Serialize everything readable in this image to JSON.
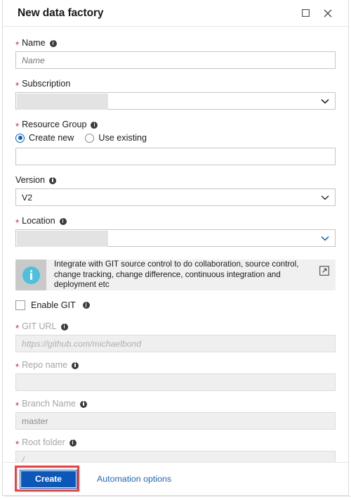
{
  "dialog": {
    "title": "New data factory",
    "titlebar_buttons": [
      {
        "name": "maximize-button",
        "icon": "maximize-icon",
        "label": "Maximize"
      },
      {
        "name": "close-button",
        "icon": "close-icon",
        "label": "Close"
      }
    ]
  },
  "fields": {
    "name": {
      "label": "Name",
      "required": true,
      "info": true,
      "placeholder": "Name",
      "value": ""
    },
    "subscription": {
      "label": "Subscription",
      "required": true,
      "info": false,
      "value": "",
      "redacted": true,
      "chevron_color": "#1b1b1b"
    },
    "resource_group": {
      "label": "Resource Group",
      "required": true,
      "info": true,
      "options": [
        {
          "label": "Create new",
          "selected": true
        },
        {
          "label": "Use existing",
          "selected": false
        }
      ],
      "value": "",
      "placeholder": ""
    },
    "version": {
      "label": "Version",
      "required": false,
      "info": true,
      "value": "V2",
      "chevron_color": "#1b1b1b"
    },
    "location": {
      "label": "Location",
      "required": true,
      "info": true,
      "value": "",
      "redacted": true,
      "chevron_color": "#1168d6"
    },
    "git_url": {
      "label": "GIT URL",
      "required": true,
      "info": true,
      "disabled": true,
      "placeholder": "https://github.com/michaelbond",
      "value": ""
    },
    "repo_name": {
      "label": "Repo name",
      "required": true,
      "info": true,
      "disabled": true,
      "placeholder": "",
      "value": ""
    },
    "branch_name": {
      "label": "Branch Name",
      "required": true,
      "info": true,
      "disabled": true,
      "placeholder": "",
      "value": "master"
    },
    "root_folder": {
      "label": "Root folder",
      "required": true,
      "info": true,
      "disabled": true,
      "placeholder": "/",
      "value": ""
    }
  },
  "banner": {
    "message": "Integrate with GIT source control to do collaboration, source control, change tracking, change difference, continuous integration and deployment etc",
    "icon": "info-circle-icon",
    "link_icon": "external-link-icon",
    "icon_color": "#4cc0de",
    "background": "#f0f0f0"
  },
  "enable_git": {
    "label": "Enable GIT",
    "checked": false,
    "info": true
  },
  "footer": {
    "create_label": "Create",
    "automation_label": "Automation options",
    "create_color": "#0c57ba",
    "link_color": "#1e66c9",
    "annotation_color": "#fd3a36"
  }
}
